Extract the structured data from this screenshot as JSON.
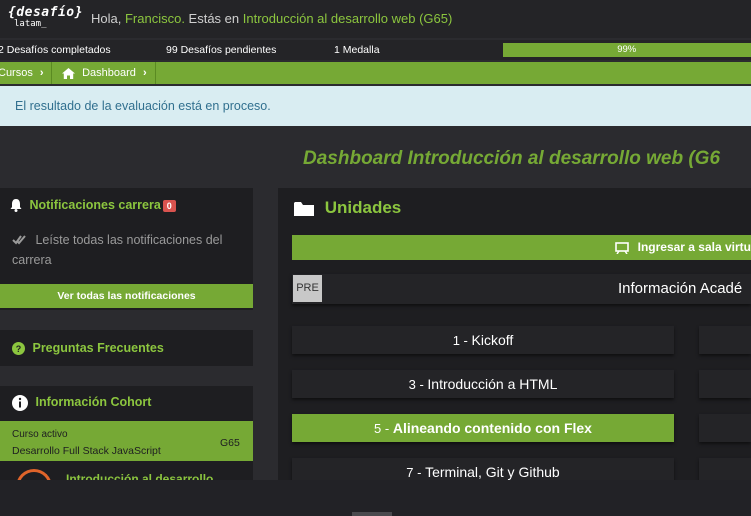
{
  "header": {
    "logo_main": "{desafío}",
    "logo_sub": "latam_",
    "greeting_prefix": "Hola, ",
    "user_name": "Francisco.",
    "greeting_mid": " Estás en ",
    "course_name": "Introducción al desarrollo web (G65)"
  },
  "stats": {
    "completed": "2 Desafíos completados",
    "pending": "99 Desafíos pendientes",
    "medals": "1 Medalla",
    "progress_label": "99%",
    "progress_value": 0.99
  },
  "breadcrumb": {
    "item1": "Cursos",
    "item2": "Dashboard"
  },
  "alert": {
    "text": "El resultado de la evaluación está en proceso."
  },
  "dashboard": {
    "title": "Dashboard Introducción al desarrollo web (G6"
  },
  "notifications": {
    "title": "Notificaciones carrera",
    "count": "0",
    "message": "Leíste todas las notificaciones del carrera",
    "button": "Ver todas las notificaciones"
  },
  "faq": {
    "title": "Preguntas Frecuentes"
  },
  "cohort": {
    "title": "Información Cohort",
    "course_label": "Curso activo",
    "course_name": "Desarrollo Full Stack JavaScript",
    "course_code": "G65",
    "next_item": "Introducción al desarrollo"
  },
  "unidades": {
    "title": "Unidades",
    "virtual_room_button": "Ingresar a sala virtu",
    "pre_label": "PRE",
    "academic_info": "Información Acadé",
    "units": [
      {
        "num": "1",
        "sep": " - ",
        "name": "Kickoff",
        "active": false
      },
      {
        "num": "3",
        "sep": " - ",
        "name": "Introducción a HTML",
        "active": false
      },
      {
        "num": "5",
        "sep": " - ",
        "name": "Alineando contenido con Flex",
        "active": true
      },
      {
        "num": "7",
        "sep": " - ",
        "name": "Terminal, Git y Github",
        "active": false
      }
    ]
  },
  "colors": {
    "accent": "#76a935",
    "accent_text": "#8cc63f",
    "alert_bg": "#d9edf2",
    "badge": "#d9534f"
  }
}
